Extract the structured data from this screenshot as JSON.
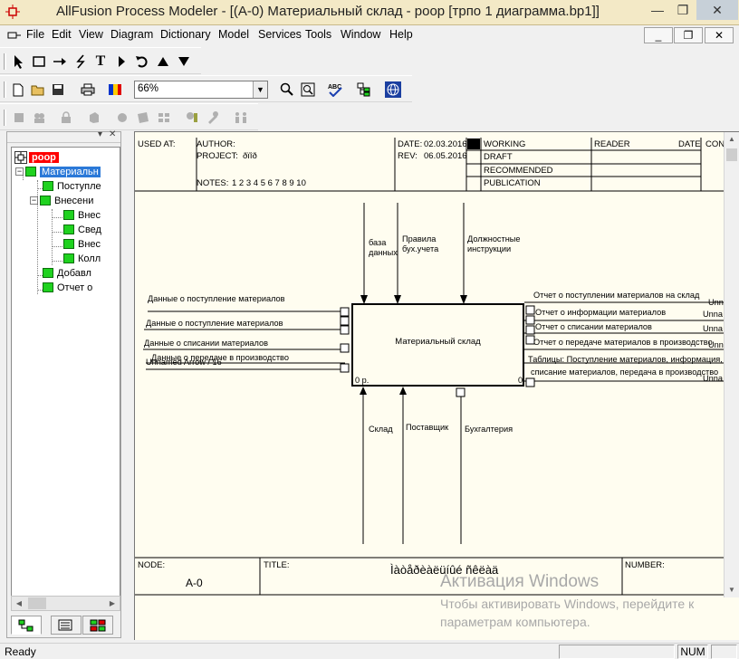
{
  "window": {
    "title": "AllFusion Process Modeler - [(A-0) Материальный склад  - poop  [трпо 1 диаграмма.bp1]]",
    "minimize_label": "—",
    "maximize_label": "❐",
    "close_label": "✕"
  },
  "menu": {
    "items": [
      "File",
      "Edit",
      "View",
      "Diagram",
      "Dictionary",
      "Model",
      "Services",
      "Tools",
      "Window",
      "Help"
    ],
    "mdi_min_label": "_",
    "mdi_restore_label": "❐",
    "mdi_close_label": "✕"
  },
  "toolbar": {
    "zoom_value": "66%"
  },
  "explorer": {
    "model_name": "poop",
    "nodes": [
      {
        "label": "Материальн",
        "level": 1,
        "selected": true
      },
      {
        "label": "Поступле",
        "level": 2
      },
      {
        "label": "Внесени",
        "level": 2
      },
      {
        "label": "Внес",
        "level": 3
      },
      {
        "label": "Свед",
        "level": 3
      },
      {
        "label": "Внес",
        "level": 3
      },
      {
        "label": "Колл",
        "level": 3
      },
      {
        "label": "Добавл",
        "level": 2
      },
      {
        "label": "Отчет о",
        "level": 2
      }
    ]
  },
  "diagram": {
    "header": {
      "used_at": "USED AT:",
      "author": "AUTHOR:",
      "project": "PROJECT:",
      "project_value": "ðïîð",
      "notes": "NOTES:",
      "notes_value": "1  2  3  4  5  6  7  8  9  10",
      "date": "DATE:",
      "date_value": "02.03.2016",
      "rev": "REV:",
      "rev_value": "06.05.2016",
      "working": "WORKING",
      "draft": "DRAFT",
      "recommended": "RECOMMENDED",
      "publication": "PUBLICATION",
      "reader": "READER",
      "date_col": "DATE",
      "context": "CONTEXT"
    },
    "box": {
      "name": "Материальный склад",
      "num_left": "0 р.",
      "num_right": "0"
    },
    "controls": [
      "база данных",
      "Правила бух.учета",
      "Должностные инструкции"
    ],
    "inputs": [
      "Данные о поступление материалов",
      "Данные о поступление материалов",
      "Данные о списании материалов",
      "Данные о передаче в производство",
      "Unnamed Arrow / 16"
    ],
    "outputs": [
      "Отчет о поступлении материалов на склад",
      "Отчет о информации материалов",
      "Отчет о списании материалов",
      "Отчет о передаче материалов в производство",
      "Таблицы: Поступление материалов, информация, с",
      "списание материалов, передача в производство"
    ],
    "output_tags": [
      "Unn",
      "Unna",
      "Unna",
      "Unna",
      "Unna"
    ],
    "mechanisms": [
      "Склад",
      "Поставщик",
      "Бухгалтерия"
    ],
    "footer": {
      "node_label": "NODE:",
      "node_value": "A-0",
      "title_label": "TITLE:",
      "title_value": "Ìàòåðèàëüíûé ñêëàä",
      "number_label": "NUMBER:"
    }
  },
  "watermark": {
    "title": "Активация Windows",
    "line1": "Чтобы активировать Windows, перейдите к",
    "line2": "параметрам компьютера."
  },
  "status": {
    "text": "Ready",
    "num": "NUM"
  }
}
